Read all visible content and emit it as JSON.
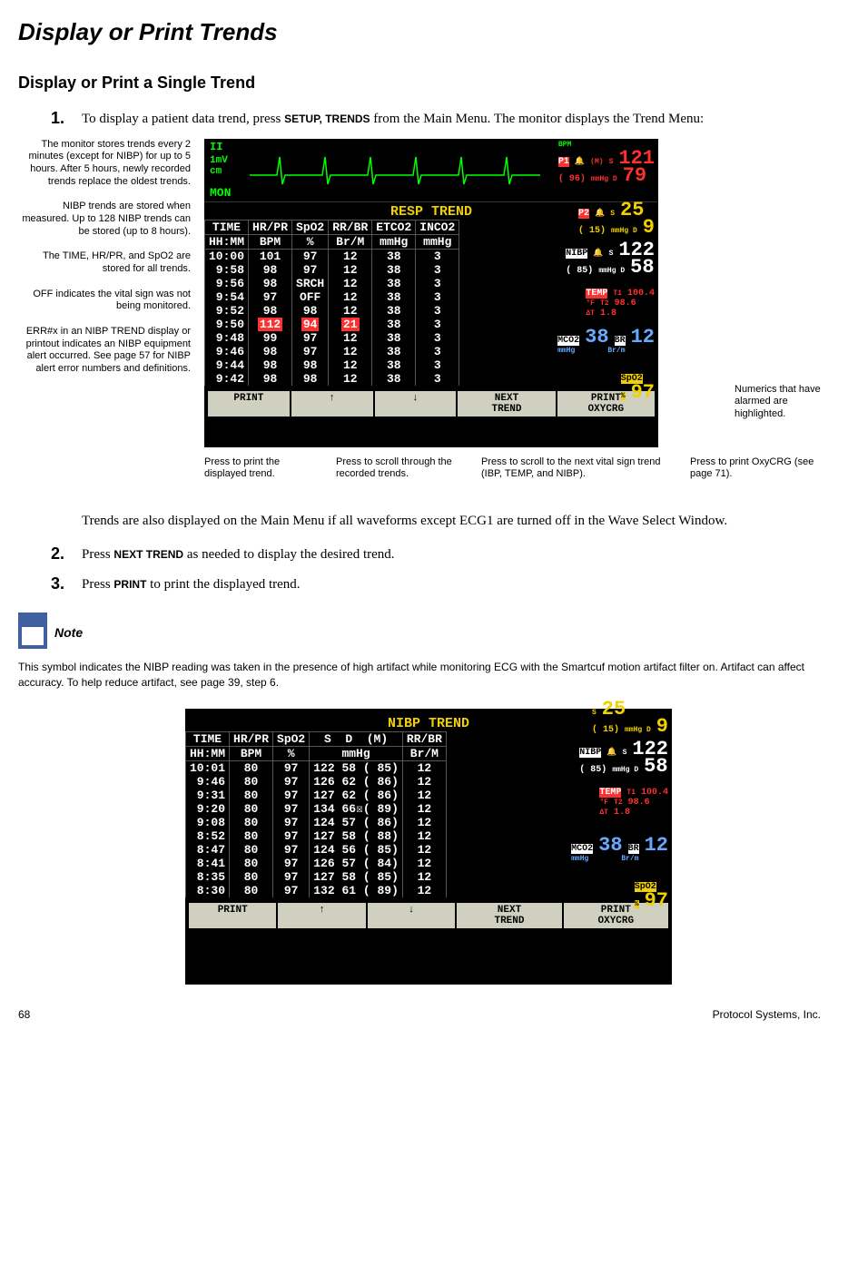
{
  "page_title": "Display or Print Trends",
  "section_title": "Display or Print a Single Trend",
  "step1": "To display a patient data trend, press ",
  "step1_cmd": "SETUP, TRENDS",
  "step1_cont": " from the Main Menu. The monitor displays the Trend Menu:",
  "callouts_left": "The monitor stores trends every 2 minutes (except for NIBP) for up to 5 hours. After 5 hours, newly recorded trends replace the oldest trends.\n\nNIBP trends are stored when measured. Up to 128 NIBP trends can be stored (up to 8 hours).\n\nThe TIME, HR/PR, and SpO2 are stored for all trends.\n\nOFF indicates the vital sign was not being monitored.\n\nERR#x in an NIBP TREND display or printout indicates an NIBP equipment alert occurred. See page 57 for NIBP alert error numbers and definitions.",
  "callout_right": "Numerics that have alarmed are highlighted.",
  "callout_b1": "Press to print the displayed trend.",
  "callout_b2": "Press to scroll through the recorded trends.",
  "callout_b3": "Press to scroll to the next vital sign trend (IBP, TEMP, and NIBP).",
  "callout_b4": "Press to print OxyCRG (see page 71).",
  "monitor1": {
    "lead": "II",
    "scale": "1mV\ncm",
    "mon": "MON",
    "bpm_label": "BPM",
    "trend_title": "RESP TREND",
    "headers": [
      "TIME",
      "HR/PR",
      "SpO2",
      "RR/BR",
      "ETCO2",
      "INCO2"
    ],
    "units": [
      "HH:MM",
      "BPM",
      "%",
      "Br/M",
      "mmHg",
      "mmHg"
    ],
    "rows": [
      [
        "10:00",
        "101",
        "97",
        "12",
        "38",
        "3"
      ],
      [
        "9:58",
        "98",
        "97",
        "12",
        "38",
        "3"
      ],
      [
        "9:56",
        "98",
        "SRCH",
        "12",
        "38",
        "3"
      ],
      [
        "9:54",
        "97",
        "OFF",
        "12",
        "38",
        "3"
      ],
      [
        "9:52",
        "98",
        "98",
        "12",
        "38",
        "3"
      ],
      [
        "9:50",
        "112",
        "94",
        "21",
        "38",
        "3"
      ],
      [
        "9:48",
        "99",
        "97",
        "12",
        "38",
        "3"
      ],
      [
        "9:46",
        "98",
        "97",
        "12",
        "38",
        "3"
      ],
      [
        "9:44",
        "98",
        "98",
        "12",
        "38",
        "3"
      ],
      [
        "9:42",
        "98",
        "98",
        "12",
        "38",
        "3"
      ]
    ],
    "p1": {
      "label": "P1",
      "m": "( 96)",
      "s": "121",
      "d": "79"
    },
    "p2": {
      "label": "P2",
      "m": "( 15)",
      "s": "25",
      "d": "9"
    },
    "nibp": {
      "label": "NIBP",
      "m": "( 85)",
      "s": "122",
      "d": "58"
    },
    "temp": {
      "label": "TEMP",
      "t1": "100.4",
      "t2": "98.6",
      "dt": "1.8"
    },
    "mco2": {
      "label": "MCO2",
      "val": "38"
    },
    "br": {
      "label": "BR",
      "val": "12"
    },
    "spo2": {
      "label": "SpO2",
      "val": "97"
    }
  },
  "buttons": {
    "print": "PRINT",
    "up": "↑",
    "down": "↓",
    "next": "NEXT\nTREND",
    "oxy": "PRINT\nOXYCRG"
  },
  "body2": "Trends are also displayed on the Main Menu if all waveforms except ECG1 are turned off in the Wave Select Window.",
  "step2": "Press ",
  "step2_cmd": "NEXT TREND",
  "step2_cont": " as needed to display the desired trend.",
  "step3": "Press ",
  "step3_cmd": "PRINT",
  "step3_cont": " to print the displayed trend.",
  "note_label": "Note",
  "note_text": "This symbol indicates the NIBP reading was taken in the presence of high artifact while monitoring ECG with the Smartcuf motion artifact filter on. Artifact can affect accuracy. To help reduce artifact, see page 39, step 6.",
  "monitor2": {
    "trend_title": "NIBP TREND",
    "headers": [
      "TIME",
      "HR/PR",
      "SpO2",
      "S  D  (M)",
      "RR/BR"
    ],
    "units": [
      "HH:MM",
      "BPM",
      "%",
      "mmHg",
      "Br/M"
    ],
    "rows": [
      [
        "10:01",
        "80",
        "97",
        "122 58 ( 85)",
        "12"
      ],
      [
        "9:46",
        "80",
        "97",
        "126 62 ( 86)",
        "12"
      ],
      [
        "9:31",
        "80",
        "97",
        "127 62 ( 86)",
        "12"
      ],
      [
        "9:20",
        "80",
        "97",
        "134 66☒( 89)",
        "12"
      ],
      [
        "9:08",
        "80",
        "97",
        "124 57 ( 86)",
        "12"
      ],
      [
        "8:52",
        "80",
        "97",
        "127 58 ( 88)",
        "12"
      ],
      [
        "8:47",
        "80",
        "97",
        "124 56 ( 85)",
        "12"
      ],
      [
        "8:41",
        "80",
        "97",
        "126 57 ( 84)",
        "12"
      ],
      [
        "8:35",
        "80",
        "97",
        "127 58 ( 85)",
        "12"
      ],
      [
        "8:30",
        "80",
        "97",
        "132 61 ( 89)",
        "12"
      ]
    ]
  },
  "footer_page": "68",
  "footer_company": "Protocol Systems, Inc."
}
